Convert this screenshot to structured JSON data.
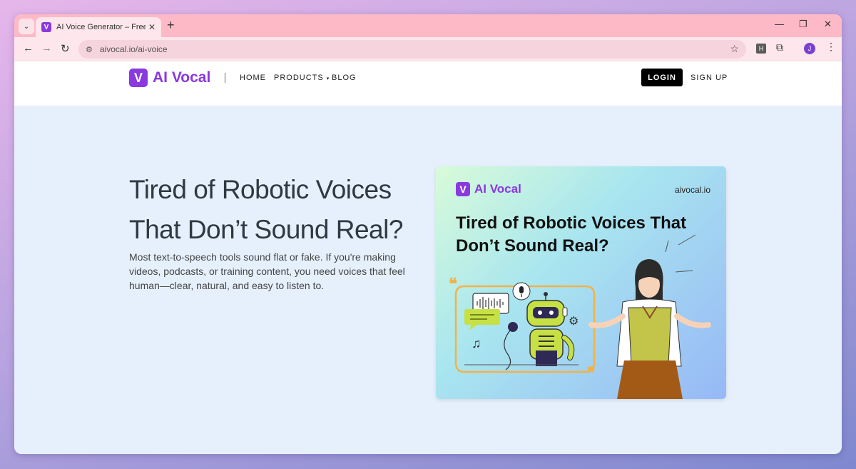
{
  "browser": {
    "tab_title": "AI Voice Generator – Free Text t",
    "tab_favicon": "V",
    "url": "aivocal.io/ai-voice",
    "profile_initial": "J",
    "extension_label": "H"
  },
  "site": {
    "logo_mark": "V",
    "logo_text": "AI Vocal",
    "nav": {
      "home": "HOME",
      "products": "PRODUCTS",
      "blog": "BLOG"
    },
    "login": "LOGIN",
    "signup": "SIGN UP",
    "brand_color": "#8a38e0"
  },
  "hero": {
    "title_line1": "Tired of Robotic Voices",
    "title_line2": "That Don’t Sound Real?",
    "body": "Most text-to-speech tools sound flat or fake. If you're making videos, podcasts, or training content, you need voices that feel human—clear, natural, and easy to listen to."
  },
  "card": {
    "logo_mark": "V",
    "logo_text": "AI Vocal",
    "domain": "aivocal.io",
    "title": "Tired of Robotic Voices That Don’t Sound Real?"
  }
}
